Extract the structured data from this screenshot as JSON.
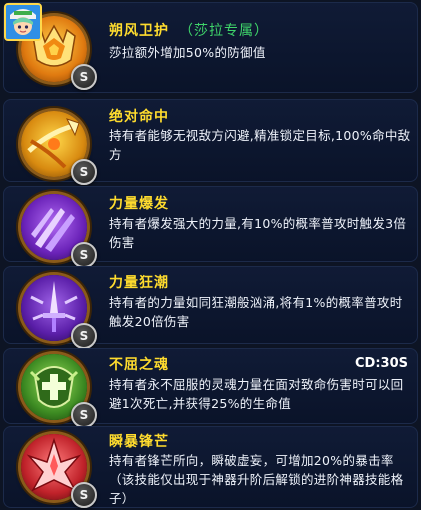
{
  "skills": [
    {
      "name": "朔风卫护",
      "tag": "（莎拉专属）",
      "desc": "莎拉额外增加50%的防御值",
      "badge": "S",
      "cd": "",
      "icon": "golden-flame-shield-icon",
      "color": "#f0a020"
    },
    {
      "name": "绝对命中",
      "tag": "",
      "desc": "持有者能够无视敌方闪避,精准锁定目标,100%命中敌方",
      "badge": "S",
      "cd": "",
      "icon": "golden-arrow-icon",
      "color": "#ffb000"
    },
    {
      "name": "力量爆发",
      "tag": "",
      "desc": "持有者爆发强大的力量,有10%的概率普攻时触发3倍伤害",
      "badge": "S",
      "cd": "",
      "icon": "purple-claw-slash-icon",
      "color": "#8a3fd8"
    },
    {
      "name": "力量狂潮",
      "tag": "",
      "desc": "持有者的力量如同狂潮般汹涌,将有1%的概率普攻时触发20倍伤害",
      "badge": "S",
      "cd": "",
      "icon": "purple-sword-burst-icon",
      "color": "#7a3ac8"
    },
    {
      "name": "不屈之魂",
      "tag": "",
      "desc": "持有者永不屈服的灵魂力量在面对致命伤害时可以回避1次死亡,并获得25%的生命值",
      "badge": "S",
      "cd": "CD:30S",
      "icon": "green-soul-cross-icon",
      "color": "#4fae3a"
    },
    {
      "name": "瞬暴锋芒",
      "tag": "",
      "desc": "持有者锋芒所向，瞬破虚妄，可增加20%的暴击率（该技能仅出现于神器升阶后解锁的进阶神器技能格子）",
      "badge": "S",
      "cd": "",
      "icon": "red-crystal-burst-icon",
      "color": "#d8323a"
    }
  ]
}
